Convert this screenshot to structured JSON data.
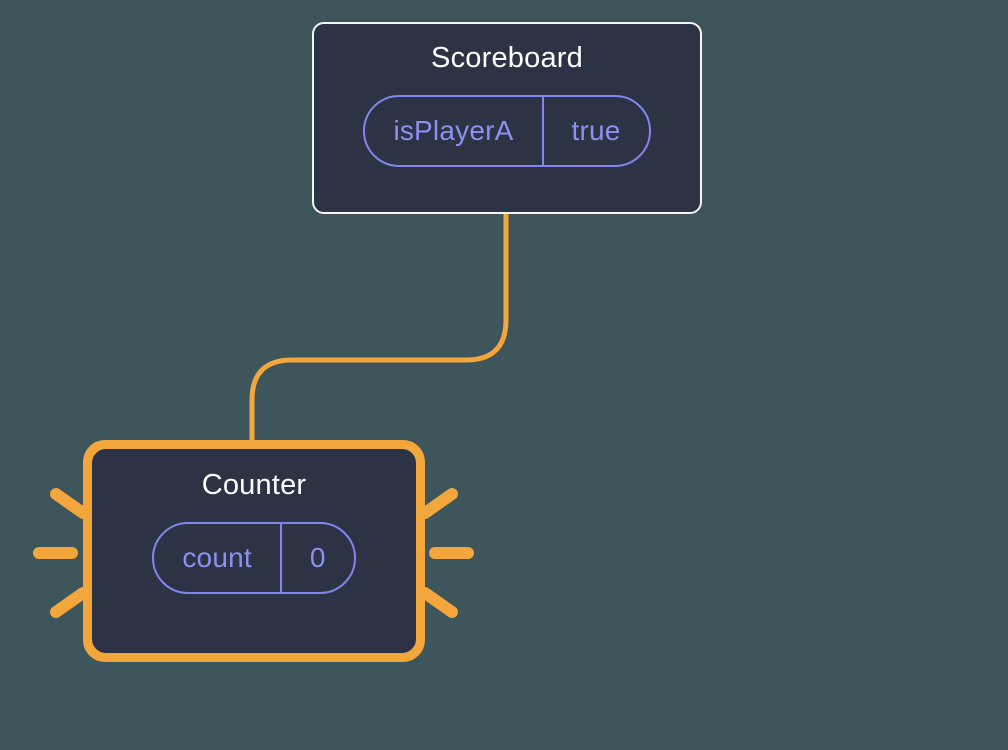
{
  "nodes": {
    "scoreboard": {
      "title": "Scoreboard",
      "state_key": "isPlayerA",
      "state_value": "true"
    },
    "counter": {
      "title": "Counter",
      "state_key": "count",
      "state_value": "0"
    }
  }
}
